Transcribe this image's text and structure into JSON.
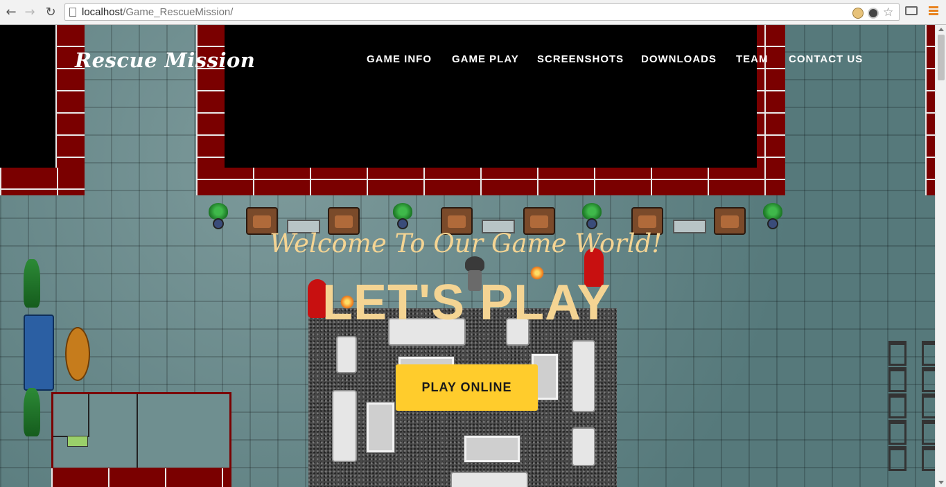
{
  "browser": {
    "url_host": "localhost",
    "url_path": "/Game_RescueMission/"
  },
  "site": {
    "logo": "Rescue Mission",
    "nav": [
      {
        "label": "GAME INFO"
      },
      {
        "label": "GAME PLAY"
      },
      {
        "label": "SCREENSHOTS"
      },
      {
        "label": "DOWNLOADS"
      },
      {
        "label": "TEAM"
      },
      {
        "label": "CONTACT US"
      }
    ]
  },
  "hero": {
    "welcome": "Welcome To Our Game World!",
    "headline": "LET'S PLAY",
    "cta": "PLAY ONLINE"
  },
  "colors": {
    "accent": "#ffcc2c",
    "hero_text": "#f4d493",
    "wall_red": "#7a0000"
  }
}
